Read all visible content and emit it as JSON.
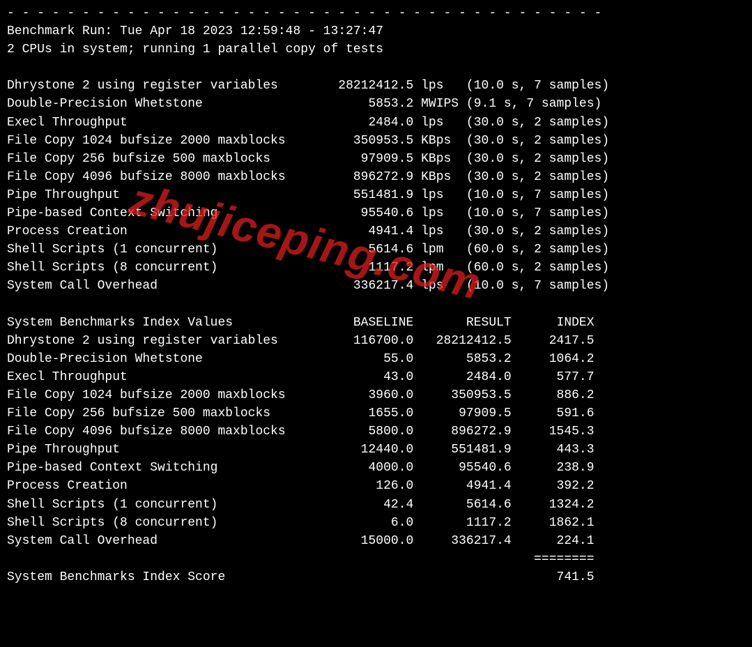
{
  "watermark": "zhujiceping.com",
  "divider": "- - - - - - - - - - - - - - - - - - - - - - - - - - - - - - - - - - - - - - - -",
  "header": {
    "run_line": "Benchmark Run: Tue Apr 18 2023 12:59:48 - 13:27:47",
    "cpu_line": "2 CPUs in system; running 1 parallel copy of tests"
  },
  "tests": [
    {
      "name": "Dhrystone 2 using register variables",
      "value": "28212412.5",
      "unit": "lps",
      "timing": "(10.0 s, 7 samples)"
    },
    {
      "name": "Double-Precision Whetstone",
      "value": "5853.2",
      "unit": "MWIPS",
      "timing": "(9.1 s, 7 samples)"
    },
    {
      "name": "Execl Throughput",
      "value": "2484.0",
      "unit": "lps",
      "timing": "(30.0 s, 2 samples)"
    },
    {
      "name": "File Copy 1024 bufsize 2000 maxblocks",
      "value": "350953.5",
      "unit": "KBps",
      "timing": "(30.0 s, 2 samples)"
    },
    {
      "name": "File Copy 256 bufsize 500 maxblocks",
      "value": "97909.5",
      "unit": "KBps",
      "timing": "(30.0 s, 2 samples)"
    },
    {
      "name": "File Copy 4096 bufsize 8000 maxblocks",
      "value": "896272.9",
      "unit": "KBps",
      "timing": "(30.0 s, 2 samples)"
    },
    {
      "name": "Pipe Throughput",
      "value": "551481.9",
      "unit": "lps",
      "timing": "(10.0 s, 7 samples)"
    },
    {
      "name": "Pipe-based Context Switching",
      "value": "95540.6",
      "unit": "lps",
      "timing": "(10.0 s, 7 samples)"
    },
    {
      "name": "Process Creation",
      "value": "4941.4",
      "unit": "lps",
      "timing": "(30.0 s, 2 samples)"
    },
    {
      "name": "Shell Scripts (1 concurrent)",
      "value": "5614.6",
      "unit": "lpm",
      "timing": "(60.0 s, 2 samples)"
    },
    {
      "name": "Shell Scripts (8 concurrent)",
      "value": "1117.2",
      "unit": "lpm",
      "timing": "(60.0 s, 2 samples)"
    },
    {
      "name": "System Call Overhead",
      "value": "336217.4",
      "unit": "lps",
      "timing": "(10.0 s, 7 samples)"
    }
  ],
  "index_header": {
    "title": "System Benchmarks Index Values",
    "baseline": "BASELINE",
    "result": "RESULT",
    "index": "INDEX"
  },
  "index_rows": [
    {
      "name": "Dhrystone 2 using register variables",
      "baseline": "116700.0",
      "result": "28212412.5",
      "index": "2417.5"
    },
    {
      "name": "Double-Precision Whetstone",
      "baseline": "55.0",
      "result": "5853.2",
      "index": "1064.2"
    },
    {
      "name": "Execl Throughput",
      "baseline": "43.0",
      "result": "2484.0",
      "index": "577.7"
    },
    {
      "name": "File Copy 1024 bufsize 2000 maxblocks",
      "baseline": "3960.0",
      "result": "350953.5",
      "index": "886.2"
    },
    {
      "name": "File Copy 256 bufsize 500 maxblocks",
      "baseline": "1655.0",
      "result": "97909.5",
      "index": "591.6"
    },
    {
      "name": "File Copy 4096 bufsize 8000 maxblocks",
      "baseline": "5800.0",
      "result": "896272.9",
      "index": "1545.3"
    },
    {
      "name": "Pipe Throughput",
      "baseline": "12440.0",
      "result": "551481.9",
      "index": "443.3"
    },
    {
      "name": "Pipe-based Context Switching",
      "baseline": "4000.0",
      "result": "95540.6",
      "index": "238.9"
    },
    {
      "name": "Process Creation",
      "baseline": "126.0",
      "result": "4941.4",
      "index": "392.2"
    },
    {
      "name": "Shell Scripts (1 concurrent)",
      "baseline": "42.4",
      "result": "5614.6",
      "index": "1324.2"
    },
    {
      "name": "Shell Scripts (8 concurrent)",
      "baseline": "6.0",
      "result": "1117.2",
      "index": "1862.1"
    },
    {
      "name": "System Call Overhead",
      "baseline": "15000.0",
      "result": "336217.4",
      "index": "224.1"
    }
  ],
  "index_sep": "========",
  "score_label": "System Benchmarks Index Score",
  "score_value": "741.5"
}
